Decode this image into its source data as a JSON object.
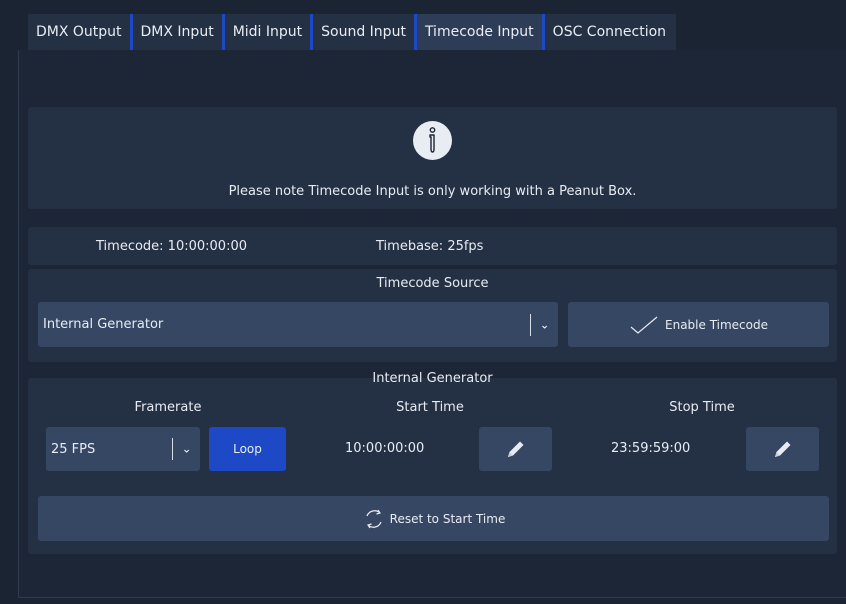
{
  "tabs": [
    {
      "label": "DMX Output"
    },
    {
      "label": "DMX Input"
    },
    {
      "label": "Midi Input"
    },
    {
      "label": "Sound Input"
    },
    {
      "label": "Timecode Input",
      "active": true
    },
    {
      "label": "OSC Connection"
    }
  ],
  "notice": {
    "icon": "info-icon",
    "text": "Please note Timecode Input is only working with a Peanut Box."
  },
  "status": {
    "timecode": "Timecode: 10:00:00:00",
    "timebase": "Timebase: 25fps"
  },
  "source": {
    "title": "Timecode Source",
    "selected": "Internal Generator",
    "enable_label": "Enable Timecode"
  },
  "generator": {
    "title": "Internal Generator",
    "framerate_label": "Framerate",
    "framerate_value": "25 FPS",
    "loop_label": "Loop",
    "start_label": "Start Time",
    "start_value": "10:00:00:00",
    "stop_label": "Stop Time",
    "stop_value": "23:59:59:00",
    "reset_label": "Reset to Start Time"
  },
  "colors": {
    "accent": "#1d48c6",
    "background": "#1b2433",
    "box": "#243044",
    "control": "#364764"
  }
}
